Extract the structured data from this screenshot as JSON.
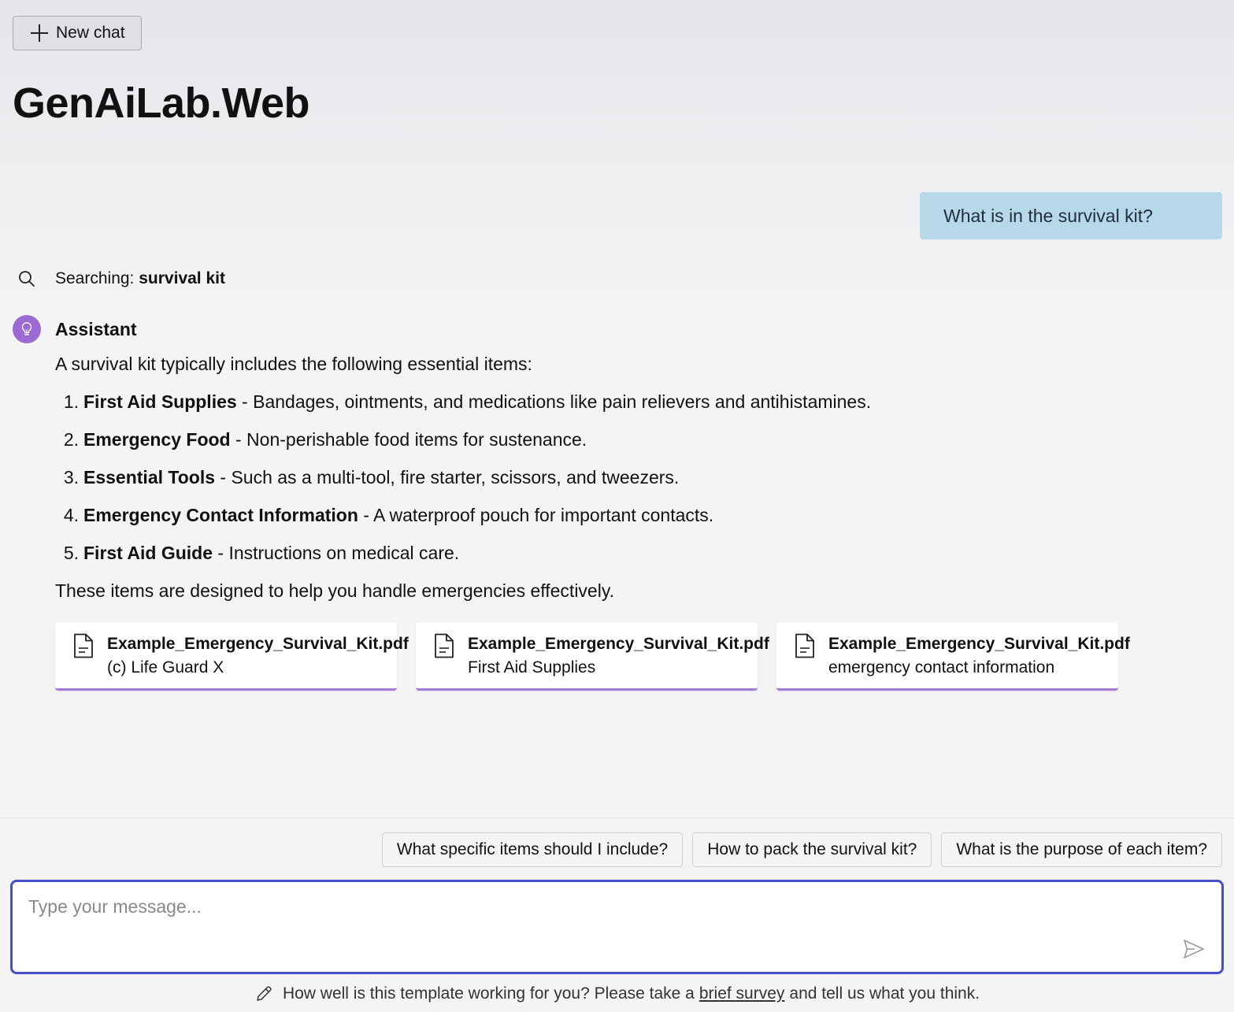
{
  "header": {
    "new_chat_label": "New chat",
    "app_title": "GenAiLab.Web"
  },
  "conversation": {
    "user_message": "What is in the survival kit?",
    "search": {
      "prefix": "Searching:",
      "query": "survival kit"
    },
    "assistant": {
      "name": "Assistant",
      "intro": "A survival kit typically includes the following essential items:",
      "items": [
        {
          "num": "1.",
          "title": "First Aid Supplies",
          "desc": " - Bandages, ointments, and medications like pain relievers and antihistamines."
        },
        {
          "num": "2.",
          "title": "Emergency Food",
          "desc": " - Non-perishable food items for sustenance."
        },
        {
          "num": "3.",
          "title": "Essential Tools",
          "desc": " - Such as a multi-tool, fire starter, scissors, and tweezers."
        },
        {
          "num": "4.",
          "title": "Emergency Contact Information",
          "desc": " - A waterproof pouch for important contacts."
        },
        {
          "num": "5.",
          "title": "First Aid Guide",
          "desc": " - Instructions on medical care."
        }
      ],
      "outro": "These items are designed to help you handle emergencies effectively.",
      "citations": [
        {
          "file": "Example_Emergency_Survival_Kit.pdf",
          "desc": "(c) Life Guard X"
        },
        {
          "file": "Example_Emergency_Survival_Kit.pdf",
          "desc": "First Aid Supplies"
        },
        {
          "file": "Example_Emergency_Survival_Kit.pdf",
          "desc": "emergency contact information"
        }
      ]
    }
  },
  "suggestions": [
    "What specific items should I include?",
    "How to pack the survival kit?",
    "What is the purpose of each item?"
  ],
  "composer": {
    "placeholder": "Type your message..."
  },
  "footer": {
    "text_before": "How well is this template working for you? Please take a",
    "link_text": "brief survey",
    "text_after": "and tell us what you think."
  },
  "colors": {
    "accent_purple": "#9b6ad3",
    "composer_border": "#4450c8",
    "user_bubble": "#b6d8e9"
  },
  "icons": [
    "plus-icon",
    "search-icon",
    "lightbulb-icon",
    "file-icon",
    "send-icon",
    "pencil-icon"
  ]
}
